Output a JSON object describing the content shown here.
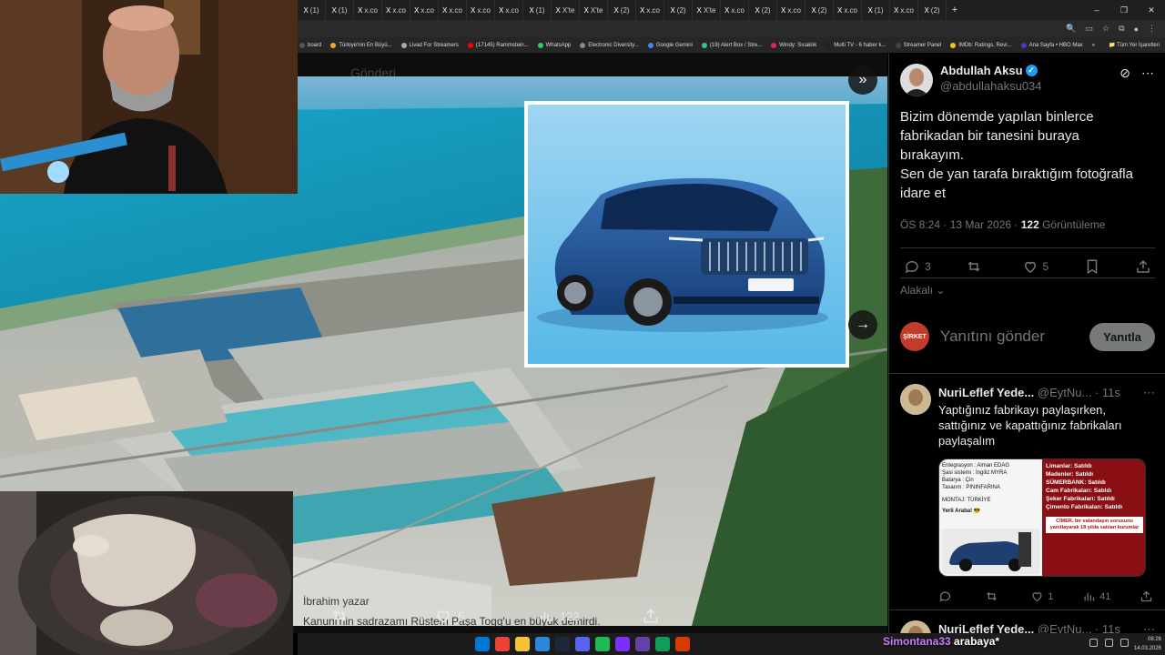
{
  "browser": {
    "tabs": [
      "(1)",
      "(1)",
      "x.co",
      "x.co",
      "x.co",
      "x.co",
      "x.co",
      "x.co",
      "(1)",
      "X'te",
      "X'te",
      "(2)",
      "x.co",
      "(2)",
      "X'te",
      "x.co",
      "(2)",
      "x.co",
      "(2)",
      "x.co",
      "(1)",
      "x.co",
      "(2)"
    ],
    "new_tab": "+",
    "window_controls": [
      "–",
      "❐",
      "✕"
    ],
    "bookmarks": [
      {
        "label": "board",
        "color": "#555"
      },
      {
        "label": "Türkiye'nin En Büyü...",
        "color": "#f5a623"
      },
      {
        "label": "Livad For Streamers",
        "color": "#aaa"
      },
      {
        "label": "(17145) Rammstein...",
        "color": "#ff0000"
      },
      {
        "label": "WhatsApp",
        "color": "#25d366"
      },
      {
        "label": "Electronic Diversity...",
        "color": "#888"
      },
      {
        "label": "Google Gemini",
        "color": "#4285f4"
      },
      {
        "label": "(19) Alert Box / Stre...",
        "color": "#31c3a2"
      },
      {
        "label": "Windy: Sıcaklık",
        "color": "#e0245e"
      },
      {
        "label": "Multi TV - 6 haber k...",
        "color": "#222"
      },
      {
        "label": "Streamer Panel",
        "color": "#444"
      },
      {
        "label": "IMDb: Ratings, Revi...",
        "color": "#f5c518"
      },
      {
        "label": "Ana Sayfa • HBO Max",
        "color": "#5b2ecc"
      }
    ],
    "bookmarks_more": "»",
    "all_bookmarks": "Tüm Yer İşaretleri"
  },
  "media": {
    "ghost_title": "Gönderi",
    "car_badge": "Togg",
    "actions": {
      "repost_count": "",
      "like_count": "5",
      "views_count": "122"
    },
    "ghost_reply_name": "İbrahim yazar",
    "ghost_reply_text": "Kanuni'nin sadrazamı Rüstem Paşa Togg'u en büyük demirdi."
  },
  "tweet": {
    "author_name": "Abdullah Aksu",
    "author_handle": "@abdullahaksu034",
    "text_lines": [
      "Bizim dönemde yapılan binlerce",
      "fabrikadan bir tanesini buraya",
      "bırakayım.",
      "Sen de yan tarafa bıraktığım fotoğrafla",
      "idare et"
    ],
    "time": "ÖS 8:24 · 13 Mar 2026 · ",
    "views_num": "122",
    "views_label": " Görüntüleme",
    "stats": {
      "replies": "3",
      "reposts": "",
      "likes": "5"
    },
    "relevance": "Alakalı",
    "compose_placeholder": "Yanıtını gönder",
    "compose_button": "Yanıtla",
    "compose_avatar_text": "ŞİRKET"
  },
  "replies": [
    {
      "name": "NuriLeflef Yede...",
      "handle": "@EytNu... · 11s",
      "text": "Yaptığınız fabrikayı paylaşırken, sattığınız ve kapattığınız fabrikaları paylaşalım",
      "image": {
        "left_lines": [
          "Entegrasyon : Alman EDAG",
          "Şasi sistemi : İngiliz MYRA",
          "Batarya : Çin",
          "Tasarım : PININFARINA",
          "",
          "MONTAJ: TÜRKİYE"
        ],
        "left_caption": "Yerli Araba! 😎",
        "right_lines": [
          "Limanlar: Satıldı",
          "Madenler: Satıldı",
          "SÜMERBANK: Satıldı",
          "Cam Fabrikaları: Satıldı",
          "Şeker Fabrikaları: Satıldı",
          "Çimento Fabrikaları: Satıldı"
        ],
        "right_caption": "CİMER, bir vatandaşın sorusunu yanıtlayarak 18 yılda satılan kurumlar"
      },
      "stats": {
        "replies": "",
        "reposts": "",
        "likes": "1",
        "views": "41"
      }
    },
    {
      "name": "NuriLeflef Yede...",
      "handle": "@EytNu... · 11s"
    }
  ],
  "taskbar": {
    "time": "08:26",
    "date": "14.03.2026",
    "apps": [
      "#0078d4",
      "#ea4335",
      "#f3c13a",
      "#2b88d8",
      "#1b2838",
      "#5865f2",
      "#1db954",
      "#7b2ff7",
      "#6441a5",
      "#0f9d58",
      "#d83b01"
    ]
  },
  "chat": {
    "user": "Simontana33",
    "message": "arabaya*"
  }
}
